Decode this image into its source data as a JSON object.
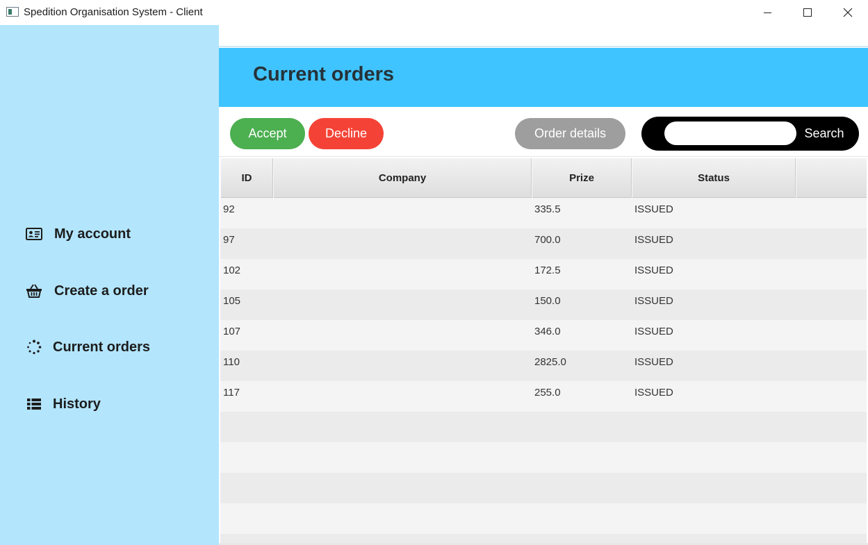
{
  "window": {
    "title": "Spedition Organisation System - Client"
  },
  "sidebar": {
    "items": [
      {
        "label": "My account",
        "icon": "id-card-icon"
      },
      {
        "label": "Create a order",
        "icon": "basket-icon"
      },
      {
        "label": "Current orders",
        "icon": "spinner-icon"
      },
      {
        "label": "History",
        "icon": "list-icon"
      }
    ]
  },
  "header": {
    "title": "Current orders"
  },
  "toolbar": {
    "accept_label": "Accept",
    "decline_label": "Decline",
    "details_label": "Order details",
    "search_label": "Search",
    "search_value": ""
  },
  "table": {
    "columns": [
      "ID",
      "Company",
      "Prize",
      "Status"
    ],
    "rows": [
      {
        "id": "92",
        "company": "",
        "prize": "335.5",
        "status": "ISSUED"
      },
      {
        "id": "97",
        "company": "",
        "prize": "700.0",
        "status": "ISSUED"
      },
      {
        "id": "102",
        "company": "",
        "prize": "172.5",
        "status": "ISSUED"
      },
      {
        "id": "105",
        "company": "",
        "prize": "150.0",
        "status": "ISSUED"
      },
      {
        "id": "107",
        "company": "",
        "prize": "346.0",
        "status": "ISSUED"
      },
      {
        "id": "110",
        "company": "",
        "prize": "2825.0",
        "status": "ISSUED"
      },
      {
        "id": "117",
        "company": "",
        "prize": "255.0",
        "status": "ISSUED"
      }
    ],
    "empty_rows": 5
  },
  "colors": {
    "sidebar_bg": "#b3e5fc",
    "header_bg": "#40c4ff",
    "accept": "#4caf50",
    "decline": "#f44336",
    "details": "#9e9e9e",
    "search_bg": "#000000"
  }
}
